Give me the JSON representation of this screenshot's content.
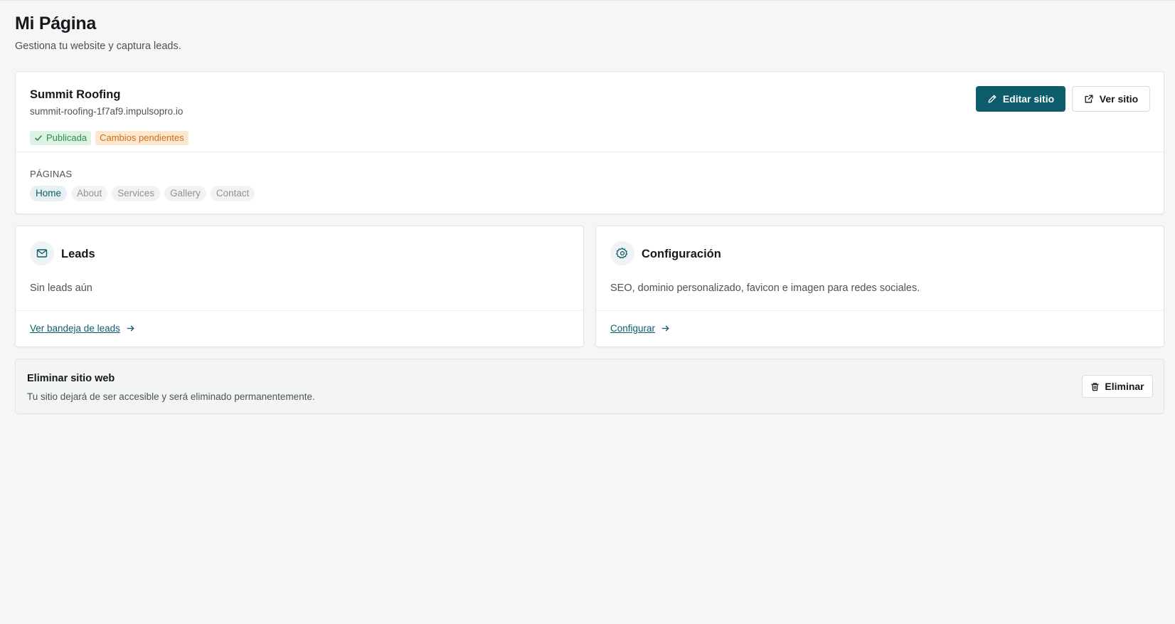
{
  "header": {
    "title": "Mi Página",
    "subtitle": "Gestiona tu website y captura leads."
  },
  "site": {
    "name": "Summit Roofing",
    "domain": "summit-roofing-1f7af9.impulsopro.io",
    "badges": {
      "published": "Publicada",
      "pending": "Cambios pendientes"
    },
    "edit_button": "Editar sitio",
    "view_button": "Ver sitio",
    "pages_label": "PÁGINAS",
    "pages": [
      "Home",
      "About",
      "Services",
      "Gallery",
      "Contact"
    ],
    "active_page": "Home"
  },
  "leads": {
    "title": "Leads",
    "text": "Sin leads aún",
    "link": "Ver bandeja de leads"
  },
  "config": {
    "title": "Configuración",
    "text": "SEO, dominio personalizado, favicon e imagen para redes sociales.",
    "link": "Configurar"
  },
  "danger": {
    "title": "Eliminar sitio web",
    "text": "Tu sitio dejará de ser accesible y será eliminado permanentemente.",
    "button": "Eliminar"
  },
  "colors": {
    "accent": "#0d5c6b",
    "background": "#f5f6f5",
    "success": "#2f8a4f",
    "warning": "#c9721c"
  },
  "icons": {
    "edit": "pencil-icon",
    "view": "external-link-icon",
    "leads": "mail-icon",
    "config": "gear-icon",
    "link": "arrow-right-icon",
    "delete": "trash-icon",
    "published": "check-icon"
  }
}
